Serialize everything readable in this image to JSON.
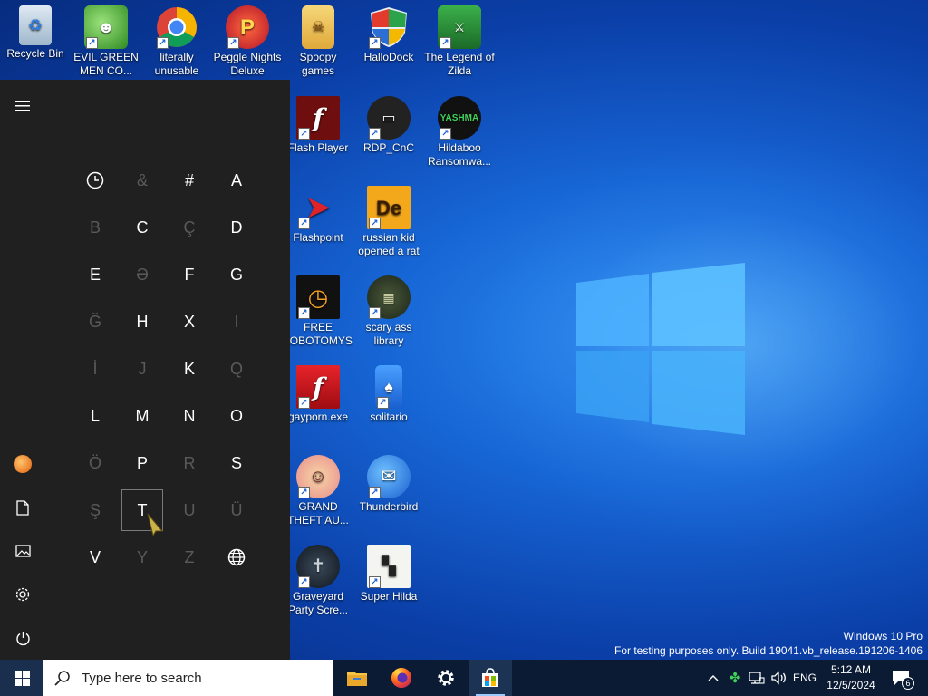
{
  "desktop_icons": [
    {
      "label": "Recycle Bin",
      "icon": "recycle-bin-icon"
    },
    {
      "label": "EVIL GREEN MEN CO...",
      "icon": "green-men-icon"
    },
    {
      "label": "literally unusable",
      "icon": "chrome-icon"
    },
    {
      "label": "Peggle Nights Deluxe",
      "icon": "peggle-icon"
    },
    {
      "label": "Spoopy games",
      "icon": "folder-icon"
    },
    {
      "label": "HalloDock",
      "icon": "shield-icon"
    },
    {
      "label": "The Legend of Zilda",
      "icon": "zilda-icon"
    },
    {
      "label": "Flash Player",
      "icon": "flash-icon"
    },
    {
      "label": "RDP_CnC",
      "icon": "rdp-icon"
    },
    {
      "label": "Hildaboo Ransomwa...",
      "icon": "yashma-icon"
    },
    {
      "label": "Flashpoint",
      "icon": "flashpoint-icon"
    },
    {
      "label": "russian kid opened a rat",
      "icon": "de-icon"
    },
    {
      "label": "FREE LOBOTOMYS",
      "icon": "clock-icon"
    },
    {
      "label": "scary ass library",
      "icon": "library-icon"
    },
    {
      "label": "gayporn.exe",
      "icon": "flash-icon"
    },
    {
      "label": "solitario",
      "icon": "solitaire-icon"
    },
    {
      "label": "GRAND THEFT AU...",
      "icon": "anime-girl-icon"
    },
    {
      "label": "Thunderbird",
      "icon": "thunderbird-icon"
    },
    {
      "label": "Graveyard Party Scre...",
      "icon": "graveyard-icon"
    },
    {
      "label": "Super Hilda",
      "icon": "super-hilda-icon"
    }
  ],
  "start_menu": {
    "menu_icon": "hamburger-icon",
    "letters": [
      {
        "text": "",
        "icon": "clock-icon",
        "enabled": true
      },
      {
        "text": "&",
        "enabled": false
      },
      {
        "text": "#",
        "enabled": true
      },
      {
        "text": "A",
        "enabled": true
      },
      {
        "text": "B",
        "enabled": false
      },
      {
        "text": "C",
        "enabled": true
      },
      {
        "text": "Ç",
        "enabled": false
      },
      {
        "text": "D",
        "enabled": true
      },
      {
        "text": "E",
        "enabled": true
      },
      {
        "text": "Ə",
        "enabled": false
      },
      {
        "text": "F",
        "enabled": true
      },
      {
        "text": "G",
        "enabled": true
      },
      {
        "text": "Ğ",
        "enabled": false
      },
      {
        "text": "H",
        "enabled": true
      },
      {
        "text": "X",
        "enabled": true
      },
      {
        "text": "I",
        "enabled": false
      },
      {
        "text": "İ",
        "enabled": false
      },
      {
        "text": "J",
        "enabled": false
      },
      {
        "text": "K",
        "enabled": true
      },
      {
        "text": "Q",
        "enabled": false
      },
      {
        "text": "L",
        "enabled": true
      },
      {
        "text": "M",
        "enabled": true
      },
      {
        "text": "N",
        "enabled": true
      },
      {
        "text": "O",
        "enabled": true
      },
      {
        "text": "Ö",
        "enabled": false
      },
      {
        "text": "P",
        "enabled": true
      },
      {
        "text": "R",
        "enabled": false
      },
      {
        "text": "S",
        "enabled": true
      },
      {
        "text": "Ş",
        "enabled": false
      },
      {
        "text": "T",
        "enabled": true,
        "selected": true
      },
      {
        "text": "U",
        "enabled": false
      },
      {
        "text": "Ü",
        "enabled": false
      },
      {
        "text": "V",
        "enabled": true
      },
      {
        "text": "Y",
        "enabled": false
      },
      {
        "text": "Z",
        "enabled": false
      },
      {
        "text": "",
        "icon": "globe-icon",
        "enabled": true
      }
    ],
    "rail": [
      "user-avatar-icon",
      "document-icon",
      "pictures-icon",
      "settings-icon",
      "power-icon"
    ]
  },
  "watermark": {
    "line1": "Windows 10 Pro",
    "line2": "For testing purposes only. Build 19041.vb_release.191206-1406"
  },
  "taskbar": {
    "search_placeholder": "Type here to search",
    "apps": [
      "file-explorer-icon",
      "firefox-icon",
      "settings-icon",
      "store-icon"
    ],
    "language": "ENG",
    "time": "5:12 AM",
    "date": "12/5/2024",
    "notification_count": "6"
  },
  "colors": {
    "start_bg": "#202020",
    "taskbar_bg": "#0a1b33",
    "accent": "#0078d7"
  }
}
